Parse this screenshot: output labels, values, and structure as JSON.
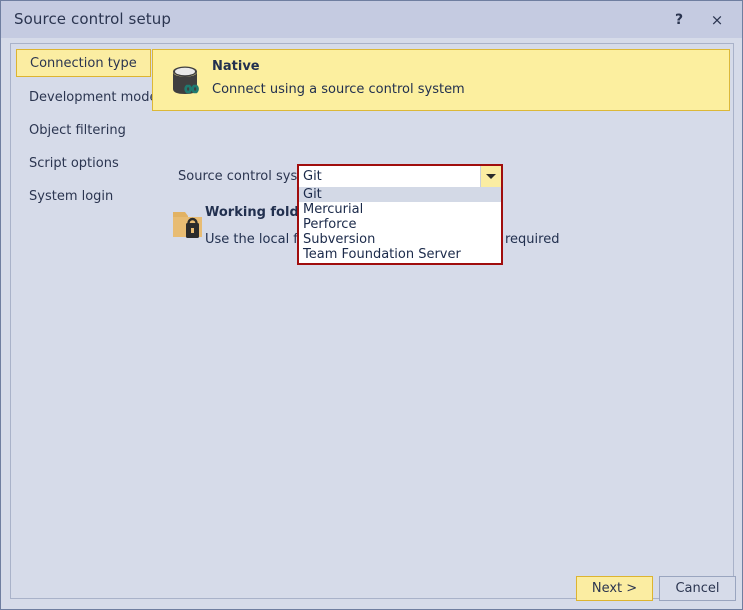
{
  "window": {
    "title": "Source control setup",
    "help_label": "?",
    "close_label": "×"
  },
  "sidebar": {
    "items": [
      {
        "label": "Connection type",
        "selected": true
      },
      {
        "label": "Development model",
        "selected": false
      },
      {
        "label": "Object filtering",
        "selected": false
      },
      {
        "label": "Script options",
        "selected": false
      },
      {
        "label": "System login",
        "selected": false
      }
    ]
  },
  "banner": {
    "icon": "database-link-icon",
    "title": "Native",
    "subtitle": "Connect using a source control system"
  },
  "form": {
    "source_control_system": {
      "label": "Source control system",
      "value": "Git",
      "options": [
        "Git",
        "Mercurial",
        "Perforce",
        "Subversion",
        "Team Foundation Server"
      ],
      "highlighted_option": "Git",
      "expanded": true
    }
  },
  "working_folder": {
    "icon": "folder-lock-icon",
    "title": "Working folder",
    "description_start": "Use the local folder",
    "description_tail": "required"
  },
  "footer": {
    "next_label": "Next >",
    "cancel_label": "Cancel"
  },
  "colors": {
    "accent_yellow": "#fcef9f",
    "accent_yellow_border": "#dcb838",
    "dialog_bg": "#d6dbe9",
    "titlebar_bg": "#c5cbe1",
    "validation_red": "#a00d0d",
    "text": "#2b3550"
  }
}
